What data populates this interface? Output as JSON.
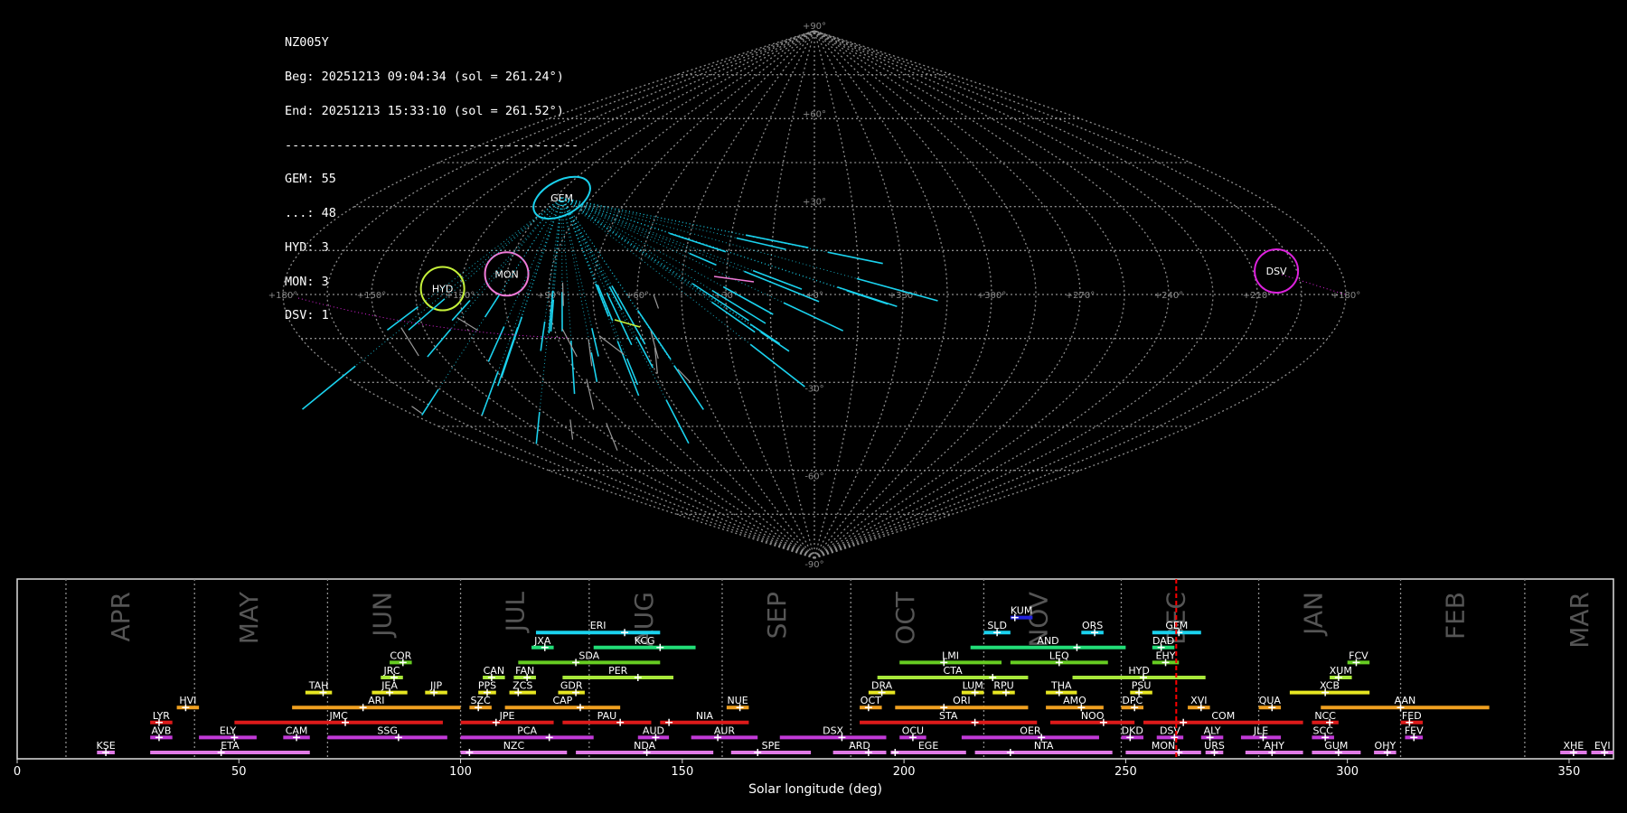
{
  "info": {
    "station": "NZ005Y",
    "begin": "Beg: 20251213 09:04:34 (sol = 261.24°)",
    "end": "End: 20251213 15:33:10 (sol = 261.52°)",
    "separator": "----------------------------------------",
    "counts": [
      "GEM: 55",
      "...: 48",
      "HYD: 3",
      "MON: 3",
      "DSV: 1"
    ]
  },
  "colors": {
    "background": "#000000",
    "grid": "#8c8c8c",
    "month_text": "#555555",
    "current_marker": "#ff0000",
    "GEM": "#1ad2ee",
    "HYD": "#c6f23a",
    "MON": "#f07ad8",
    "DSV": "#dd22dd",
    "sporadic": "#9a9a9a"
  },
  "chart_data": [
    {
      "type": "scatter",
      "projection": "sinusoidal-sky",
      "grid": true,
      "lon_labels": [
        "+180°",
        "+150°",
        "+120°",
        "+90°",
        "+60°",
        "+30°",
        "+0°",
        "+330°",
        "+300°",
        "+270°",
        "+240°",
        "+210°",
        "+180°"
      ],
      "lat_labels": [
        "+90°",
        "+60°",
        "+30°",
        "-30°",
        "-60°",
        "-90°"
      ],
      "radiants": [
        {
          "name": "GEM",
          "lon": 102,
          "lat": 33,
          "color": "#1ad2ee"
        },
        {
          "name": "HYD",
          "lon": 126,
          "lat": 2,
          "color": "#c6f23a"
        },
        {
          "name": "MON",
          "lon": 105,
          "lat": 7,
          "color": "#f07ad8"
        },
        {
          "name": "DSV",
          "lon": 202,
          "lat": 8,
          "color": "#dd22dd"
        }
      ]
    },
    {
      "type": "gantt",
      "xlabel": "Solar longitude (deg)",
      "xlim": [
        0,
        360
      ],
      "xticks": [
        0,
        50,
        100,
        150,
        200,
        250,
        300,
        350
      ],
      "current_sol": 261.4,
      "months": [
        {
          "label": "APR",
          "sol": 11
        },
        {
          "label": "MAY",
          "sol": 40
        },
        {
          "label": "JUN",
          "sol": 70
        },
        {
          "label": "JUL",
          "sol": 100
        },
        {
          "label": "AUG",
          "sol": 129
        },
        {
          "label": "SEP",
          "sol": 159
        },
        {
          "label": "OCT",
          "sol": 188
        },
        {
          "label": "NOV",
          "sol": 218
        },
        {
          "label": "DEC",
          "sol": 249
        },
        {
          "label": "JAN",
          "sol": 280
        },
        {
          "label": "FEB",
          "sol": 312
        },
        {
          "label": "MAR",
          "sol": 340
        }
      ],
      "showers": [
        {
          "name": "KUM",
          "start": 224,
          "end": 229,
          "peak": 225,
          "row": 10,
          "color": "#2222dd"
        },
        {
          "name": "ERI",
          "start": 117,
          "end": 145,
          "peak": 137,
          "row": 9,
          "color": "#1ad2ee"
        },
        {
          "name": "SLD",
          "start": 218,
          "end": 224,
          "peak": 221,
          "row": 9,
          "color": "#1ad2ee"
        },
        {
          "name": "ORS",
          "start": 240,
          "end": 245,
          "peak": 243,
          "row": 9,
          "color": "#1ad2ee"
        },
        {
          "name": "GEM",
          "start": 256,
          "end": 267,
          "peak": 262,
          "row": 9,
          "color": "#1ad2ee"
        },
        {
          "name": "JXA",
          "start": 116,
          "end": 121,
          "peak": 119,
          "row": 8,
          "color": "#22dd77"
        },
        {
          "name": "KCG",
          "start": 130,
          "end": 153,
          "peak": 145,
          "row": 8,
          "color": "#22dd77"
        },
        {
          "name": "AND",
          "start": 215,
          "end": 250,
          "peak": 239,
          "row": 8,
          "color": "#22dd77"
        },
        {
          "name": "DAD",
          "start": 256,
          "end": 261,
          "peak": 258,
          "row": 8,
          "color": "#22dd77"
        },
        {
          "name": "COR",
          "start": 84,
          "end": 89,
          "peak": 87,
          "row": 7,
          "color": "#66cc22"
        },
        {
          "name": "SDA",
          "start": 113,
          "end": 145,
          "peak": 126,
          "row": 7,
          "color": "#66cc22"
        },
        {
          "name": "LMI",
          "start": 199,
          "end": 222,
          "peak": 209,
          "row": 7,
          "color": "#66cc22"
        },
        {
          "name": "LEQ",
          "start": 224,
          "end": 246,
          "peak": 235,
          "row": 7,
          "color": "#66cc22"
        },
        {
          "name": "EHY",
          "start": 256,
          "end": 262,
          "peak": 259,
          "row": 7,
          "color": "#66cc22"
        },
        {
          "name": "FCV",
          "start": 300,
          "end": 305,
          "peak": 302,
          "row": 7,
          "color": "#66cc22"
        },
        {
          "name": "JRC",
          "start": 82,
          "end": 87,
          "peak": 85,
          "row": 6,
          "color": "#a8e83a"
        },
        {
          "name": "CAN",
          "start": 105,
          "end": 110,
          "peak": 107,
          "row": 6,
          "color": "#a8e83a"
        },
        {
          "name": "FAN",
          "start": 112,
          "end": 117,
          "peak": 115,
          "row": 6,
          "color": "#a8e83a"
        },
        {
          "name": "PER",
          "start": 123,
          "end": 148,
          "peak": 140,
          "row": 6,
          "color": "#a8e83a"
        },
        {
          "name": "CTA",
          "start": 194,
          "end": 228,
          "peak": 220,
          "row": 6,
          "color": "#a8e83a"
        },
        {
          "name": "HYD",
          "start": 238,
          "end": 268,
          "peak": 254,
          "row": 6,
          "color": "#a8e83a"
        },
        {
          "name": "XUM",
          "start": 296,
          "end": 301,
          "peak": 298,
          "row": 6,
          "color": "#a8e83a"
        },
        {
          "name": "TAH",
          "start": 65,
          "end": 71,
          "peak": 69,
          "row": 5,
          "color": "#e6e622"
        },
        {
          "name": "JEA",
          "start": 80,
          "end": 88,
          "peak": 84,
          "row": 5,
          "color": "#e6e622"
        },
        {
          "name": "JIP",
          "start": 92,
          "end": 97,
          "peak": 94,
          "row": 5,
          "color": "#e6e622"
        },
        {
          "name": "PPS",
          "start": 104,
          "end": 108,
          "peak": 106,
          "row": 5,
          "color": "#e6e622"
        },
        {
          "name": "ZCS",
          "start": 111,
          "end": 117,
          "peak": 113,
          "row": 5,
          "color": "#e6e622"
        },
        {
          "name": "GDR",
          "start": 122,
          "end": 128,
          "peak": 126,
          "row": 5,
          "color": "#e6e622"
        },
        {
          "name": "DRA",
          "start": 192,
          "end": 198,
          "peak": 195,
          "row": 5,
          "color": "#e6e622"
        },
        {
          "name": "LUM",
          "start": 213,
          "end": 218,
          "peak": 216,
          "row": 5,
          "color": "#e6e622"
        },
        {
          "name": "RPU",
          "start": 220,
          "end": 225,
          "peak": 223,
          "row": 5,
          "color": "#e6e622"
        },
        {
          "name": "THA",
          "start": 232,
          "end": 239,
          "peak": 235,
          "row": 5,
          "color": "#e6e622"
        },
        {
          "name": "PSU",
          "start": 251,
          "end": 256,
          "peak": 253,
          "row": 5,
          "color": "#e6e622"
        },
        {
          "name": "XCB",
          "start": 287,
          "end": 305,
          "peak": 295,
          "row": 5,
          "color": "#e6e622"
        },
        {
          "name": "HVI",
          "start": 36,
          "end": 41,
          "peak": 38,
          "row": 4,
          "color": "#f0a020"
        },
        {
          "name": "ARI",
          "start": 62,
          "end": 100,
          "peak": 78,
          "row": 4,
          "color": "#f0a020"
        },
        {
          "name": "SZC",
          "start": 102,
          "end": 107,
          "peak": 104,
          "row": 4,
          "color": "#f0a020"
        },
        {
          "name": "CAP",
          "start": 110,
          "end": 136,
          "peak": 127,
          "row": 4,
          "color": "#f0a020"
        },
        {
          "name": "NUE",
          "start": 160,
          "end": 165,
          "peak": 163,
          "row": 4,
          "color": "#f0a020"
        },
        {
          "name": "OCT",
          "start": 190,
          "end": 195,
          "peak": 192,
          "row": 4,
          "color": "#f0a020"
        },
        {
          "name": "ORI",
          "start": 198,
          "end": 228,
          "peak": 209,
          "row": 4,
          "color": "#f0a020"
        },
        {
          "name": "AMO",
          "start": 232,
          "end": 245,
          "peak": 240,
          "row": 4,
          "color": "#f0a020"
        },
        {
          "name": "DPC",
          "start": 249,
          "end": 254,
          "peak": 252,
          "row": 4,
          "color": "#f0a020"
        },
        {
          "name": "XVI",
          "start": 264,
          "end": 269,
          "peak": 267,
          "row": 4,
          "color": "#f0a020"
        },
        {
          "name": "QUA",
          "start": 280,
          "end": 285,
          "peak": 283,
          "row": 4,
          "color": "#f0a020"
        },
        {
          "name": "AAN",
          "start": 294,
          "end": 332,
          "peak": 312,
          "row": 4,
          "color": "#f0a020"
        },
        {
          "name": "LYR",
          "start": 30,
          "end": 35,
          "peak": 32,
          "row": 3,
          "color": "#dd1a1a"
        },
        {
          "name": "JMC",
          "start": 49,
          "end": 96,
          "peak": 74,
          "row": 3,
          "color": "#dd1a1a"
        },
        {
          "name": "JPE",
          "start": 100,
          "end": 121,
          "peak": 108,
          "row": 3,
          "color": "#dd1a1a"
        },
        {
          "name": "PAU",
          "start": 123,
          "end": 143,
          "peak": 136,
          "row": 3,
          "color": "#dd1a1a"
        },
        {
          "name": "NIA",
          "start": 145,
          "end": 165,
          "peak": 147,
          "row": 3,
          "color": "#dd1a1a"
        },
        {
          "name": "STA",
          "start": 190,
          "end": 230,
          "peak": 216,
          "row": 3,
          "color": "#dd1a1a"
        },
        {
          "name": "NOO",
          "start": 233,
          "end": 252,
          "peak": 245,
          "row": 3,
          "color": "#dd1a1a"
        },
        {
          "name": "COM",
          "start": 254,
          "end": 290,
          "peak": 263,
          "row": 3,
          "color": "#dd1a1a"
        },
        {
          "name": "NCC",
          "start": 292,
          "end": 298,
          "peak": 296,
          "row": 3,
          "color": "#dd1a1a"
        },
        {
          "name": "FED",
          "start": 312,
          "end": 317,
          "peak": 314,
          "row": 3,
          "color": "#dd1a1a"
        },
        {
          "name": "AVB",
          "start": 30,
          "end": 35,
          "peak": 32,
          "row": 2,
          "color": "#c23ad8"
        },
        {
          "name": "ELY",
          "start": 41,
          "end": 54,
          "peak": 49,
          "row": 2,
          "color": "#c23ad8"
        },
        {
          "name": "CAM",
          "start": 60,
          "end": 66,
          "peak": 63,
          "row": 2,
          "color": "#c23ad8"
        },
        {
          "name": "SSG",
          "start": 70,
          "end": 97,
          "peak": 86,
          "row": 2,
          "color": "#c23ad8"
        },
        {
          "name": "PCA",
          "start": 100,
          "end": 130,
          "peak": 120,
          "row": 2,
          "color": "#c23ad8"
        },
        {
          "name": "AUD",
          "start": 140,
          "end": 147,
          "peak": 144,
          "row": 2,
          "color": "#c23ad8"
        },
        {
          "name": "AUR",
          "start": 152,
          "end": 167,
          "peak": 158,
          "row": 2,
          "color": "#c23ad8"
        },
        {
          "name": "DSX",
          "start": 172,
          "end": 196,
          "peak": 186,
          "row": 2,
          "color": "#c23ad8"
        },
        {
          "name": "OCU",
          "start": 199,
          "end": 205,
          "peak": 202,
          "row": 2,
          "color": "#c23ad8"
        },
        {
          "name": "OER",
          "start": 213,
          "end": 244,
          "peak": 231,
          "row": 2,
          "color": "#c23ad8"
        },
        {
          "name": "DKD",
          "start": 249,
          "end": 254,
          "peak": 251,
          "row": 2,
          "color": "#c23ad8"
        },
        {
          "name": "DSV",
          "start": 257,
          "end": 263,
          "peak": 261,
          "row": 2,
          "color": "#c23ad8"
        },
        {
          "name": "ALY",
          "start": 267,
          "end": 272,
          "peak": 269,
          "row": 2,
          "color": "#c23ad8"
        },
        {
          "name": "JLE",
          "start": 276,
          "end": 285,
          "peak": 281,
          "row": 2,
          "color": "#c23ad8"
        },
        {
          "name": "SCC",
          "start": 292,
          "end": 297,
          "peak": 295,
          "row": 2,
          "color": "#c23ad8"
        },
        {
          "name": "FEV",
          "start": 313,
          "end": 317,
          "peak": 315,
          "row": 2,
          "color": "#c23ad8"
        },
        {
          "name": "KSE",
          "start": 18,
          "end": 22,
          "peak": 20,
          "row": 1,
          "color": "#e07ae6"
        },
        {
          "name": "ETA",
          "start": 30,
          "end": 66,
          "peak": 46,
          "row": 1,
          "color": "#e07ae6"
        },
        {
          "name": "NZC",
          "start": 100,
          "end": 124,
          "peak": 102,
          "row": 1,
          "color": "#e07ae6"
        },
        {
          "name": "NDA",
          "start": 126,
          "end": 157,
          "peak": 142,
          "row": 1,
          "color": "#e07ae6"
        },
        {
          "name": "SPE",
          "start": 161,
          "end": 179,
          "peak": 167,
          "row": 1,
          "color": "#e07ae6"
        },
        {
          "name": "ARD",
          "start": 184,
          "end": 196,
          "peak": 192,
          "row": 1,
          "color": "#e07ae6"
        },
        {
          "name": "EGE",
          "start": 197,
          "end": 214,
          "peak": 198,
          "row": 1,
          "color": "#e07ae6"
        },
        {
          "name": "NTA",
          "start": 216,
          "end": 247,
          "peak": 224,
          "row": 1,
          "color": "#e07ae6"
        },
        {
          "name": "MON",
          "start": 250,
          "end": 267,
          "peak": 262,
          "row": 1,
          "color": "#e07ae6"
        },
        {
          "name": "URS",
          "start": 268,
          "end": 272,
          "peak": 270,
          "row": 1,
          "color": "#e07ae6"
        },
        {
          "name": "AHY",
          "start": 277,
          "end": 290,
          "peak": 283,
          "row": 1,
          "color": "#e07ae6"
        },
        {
          "name": "GUM",
          "start": 292,
          "end": 303,
          "peak": 298,
          "row": 1,
          "color": "#e07ae6"
        },
        {
          "name": "OHY",
          "start": 306,
          "end": 311,
          "peak": 309,
          "row": 1,
          "color": "#e07ae6"
        },
        {
          "name": "XHE",
          "start": 348,
          "end": 354,
          "peak": 351,
          "row": 1,
          "color": "#e07ae6"
        },
        {
          "name": "EVI",
          "start": 355,
          "end": 360,
          "peak": 358,
          "row": 1,
          "color": "#e07ae6"
        }
      ]
    }
  ]
}
